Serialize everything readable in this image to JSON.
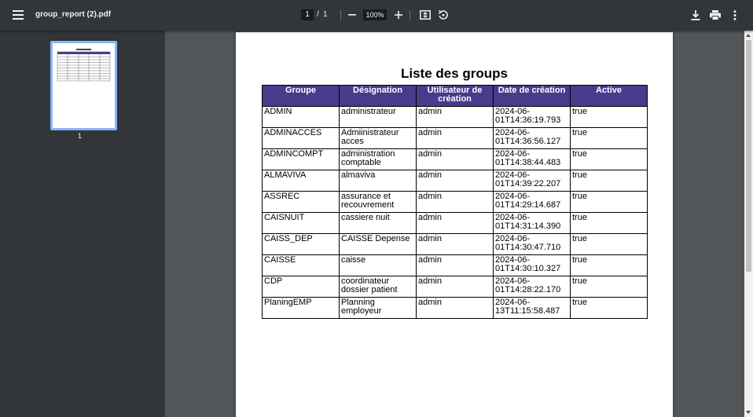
{
  "toolbar": {
    "file_name": "group_report (2).pdf",
    "current_page": "1",
    "page_separator": "/",
    "total_pages": "1",
    "zoom": "100%",
    "icons": [
      "menu-icon",
      "zoom-out-icon",
      "zoom-in-icon",
      "fit-page-icon",
      "rotate-icon",
      "download-icon",
      "print-icon",
      "more-icon"
    ]
  },
  "sidebar": {
    "thumbnails": [
      {
        "page_label": "1"
      }
    ]
  },
  "document": {
    "title": "Liste des groups",
    "columns": [
      "Groupe",
      "Désignation",
      "Utilisateur de création",
      "Date de création",
      "Active"
    ],
    "rows": [
      [
        "ADMIN",
        "administrateur",
        "admin",
        "2024-06-01T14:36:19.793",
        "true"
      ],
      [
        "ADMINACCES",
        "Admiinistrateur acces",
        "admin",
        "2024-06-01T14:36:56.127",
        "true"
      ],
      [
        "ADMINCOMPT",
        "administration comptable",
        "admin",
        "2024-06-01T14:38:44.483",
        "true"
      ],
      [
        "ALMAVIVA",
        "almaviva",
        "admin",
        "2024-06-01T14:39:22.207",
        "true"
      ],
      [
        "ASSREC",
        "assurance et recouvrement",
        "admin",
        "2024-06-01T14:29:14.687",
        "true"
      ],
      [
        "CAISNUIT",
        "cassiere nuit",
        "admin",
        "2024-06-01T14:31:14.390",
        "true"
      ],
      [
        "CAISS_DEP",
        "CAISSE Depense",
        "admin",
        "2024-06-01T14:30:47.710",
        "true"
      ],
      [
        "CAISSE",
        "caisse",
        "admin",
        "2024-06-01T14:30:10.327",
        "true"
      ],
      [
        "CDP",
        "coordinateur dossier patient",
        "admin",
        "2024-06-01T14:28:22.170",
        "true"
      ],
      [
        "PlaningEMP",
        "Planning employeur",
        "admin",
        "2024-06-13T11:15:58.487",
        "true"
      ]
    ],
    "header_color": "#473b8c"
  }
}
